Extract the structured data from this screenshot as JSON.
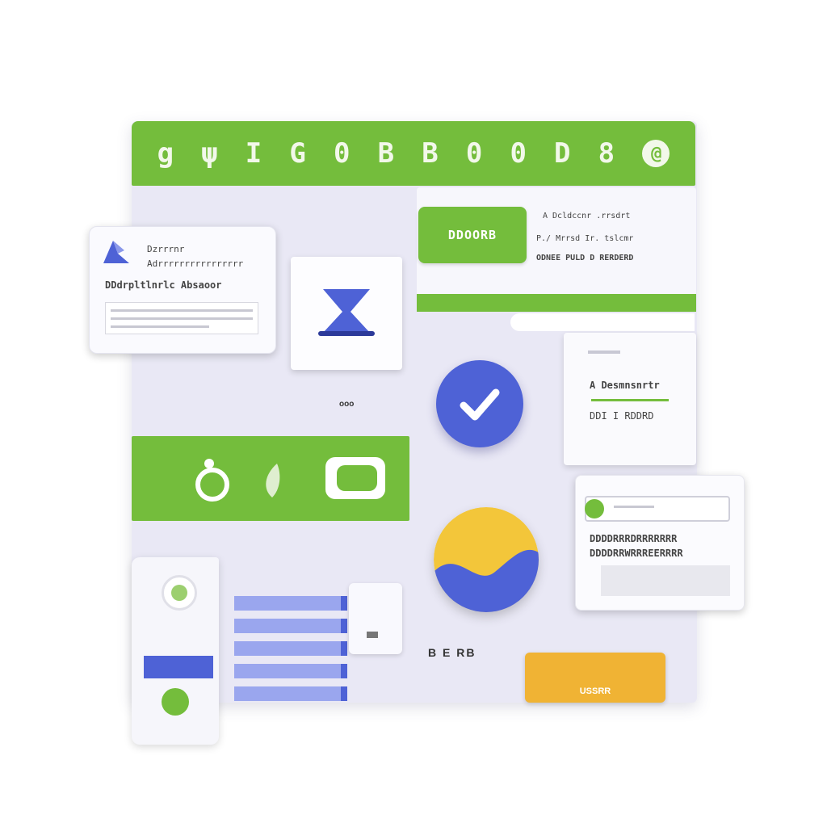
{
  "topbar": {
    "glyphs": [
      "g",
      "ψ",
      "I",
      "G",
      "0",
      "B",
      "B",
      "0",
      "0",
      "D",
      "8",
      "@"
    ]
  },
  "top_panel": {
    "button_label": "DDOORB",
    "lines": [
      "A Dcldccnr .rrsdrt",
      "P./ Mrrsd Ir. tslcmr",
      "ODNEE PULD D RERDERD"
    ]
  },
  "left_card": {
    "line1": "Dzrrrnr",
    "line2": "Adrrrrrrrrrrrrrrrr",
    "line3": "DDdrpltlnrlc Absaoor"
  },
  "hourglass_tile": {
    "caption": "ooo"
  },
  "right_card": {
    "line1": "A Desmnsnrtr",
    "line2": "DDI I RDDRD"
  },
  "right_card2": {
    "line1": "DDDDRRRDRRRRRRR",
    "line2": "DDDDRRWRRREERRRR"
  },
  "bottom": {
    "label": "B E RB",
    "orange_button_label": "USSRR"
  },
  "colors": {
    "green": "#74bd3c",
    "blue": "#4e62d6",
    "yellow": "#f0b334",
    "board": "#e9e8f5"
  },
  "icons": {
    "hourglass": "hourglass-icon",
    "check": "check-icon",
    "swoosh": "swoosh-icon",
    "mid_icons": [
      "ring-icon",
      "leaf-icon",
      "chat-bubble-icon"
    ]
  }
}
